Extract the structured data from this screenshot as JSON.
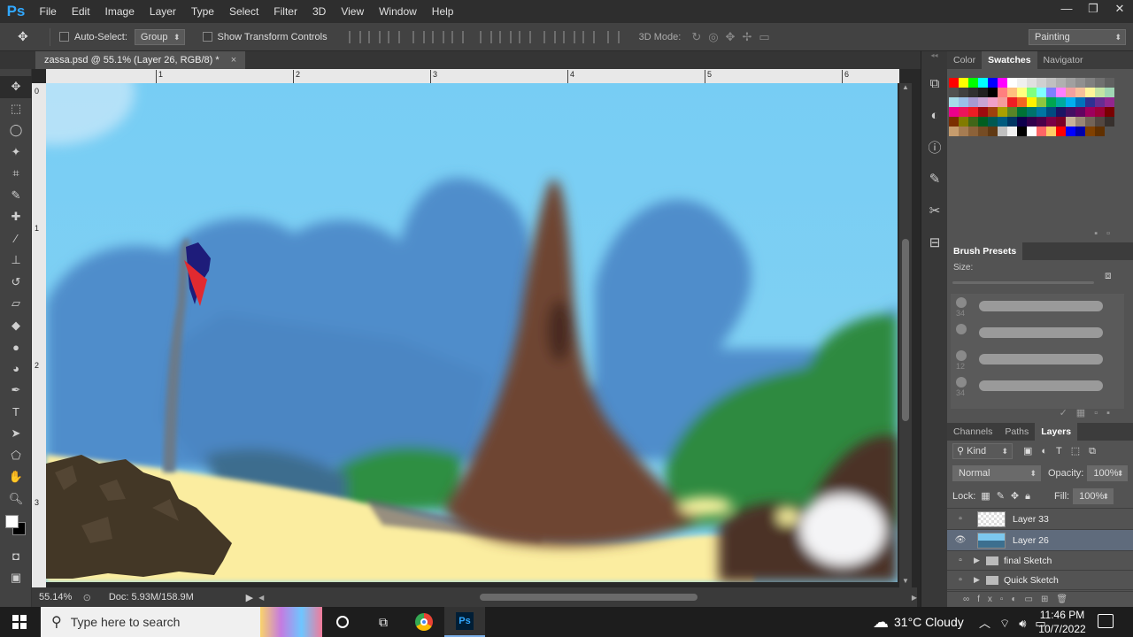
{
  "app": {
    "logo": "Ps"
  },
  "menu": [
    "File",
    "Edit",
    "Image",
    "Layer",
    "Type",
    "Select",
    "Filter",
    "3D",
    "View",
    "Window",
    "Help"
  ],
  "window_controls": {
    "minimize": "—",
    "maximize": "❐",
    "close": "✕"
  },
  "options": {
    "auto_select_label": "Auto-Select:",
    "auto_select_value": "Group",
    "show_transform_label": "Show Transform Controls",
    "mode_3d_label": "3D Mode:",
    "workspace": "Painting"
  },
  "document": {
    "tab_title": "zassa.psd @ 55.1% (Layer 26, RGB/8) *",
    "close": "×"
  },
  "ruler": {
    "top": [
      "1",
      "2",
      "3",
      "4",
      "5",
      "6"
    ],
    "left": [
      "0",
      "1",
      "2",
      "3"
    ]
  },
  "status": {
    "zoom": "55.14%",
    "doc": "Doc: 5.93M/158.9M"
  },
  "panels": {
    "color_tabs": [
      "Color",
      "Swatches",
      "Navigator"
    ],
    "active_color_tab": "Swatches",
    "brush_presets_title": "Brush Presets",
    "brush_size_label": "Size:",
    "brush_sizes": [
      "34",
      "",
      "12",
      "34"
    ],
    "layer_tabs": [
      "Channels",
      "Paths",
      "Layers"
    ],
    "active_layer_tab": "Layers",
    "filter_kind": "Kind",
    "blend_mode": "Normal",
    "opacity_label": "Opacity:",
    "opacity_value": "100%",
    "lock_label": "Lock:",
    "fill_label": "Fill:",
    "fill_value": "100%"
  },
  "layers": [
    {
      "name": "Layer 33",
      "visible": false,
      "type": "layer",
      "selected": false
    },
    {
      "name": "Layer 26",
      "visible": true,
      "type": "layer",
      "selected": true
    },
    {
      "name": "final Sketch",
      "visible": false,
      "type": "group",
      "selected": false
    },
    {
      "name": "Quick Sketch",
      "visible": false,
      "type": "group",
      "selected": false
    }
  ],
  "swatches": [
    "#ff0000",
    "#ffff00",
    "#00ff00",
    "#00ffff",
    "#0000ff",
    "#ff00ff",
    "#ffffff",
    "#f0f0f0",
    "#e0e0e0",
    "#d0d0d0",
    "#c0c0c0",
    "#b0b0b0",
    "#a0a0a0",
    "#909090",
    "#808080",
    "#707070",
    "#606060",
    "#505050",
    "#404040",
    "#303030",
    "#202020",
    "#000000",
    "#ff7f7f",
    "#ffbf7f",
    "#ffff7f",
    "#7fff7f",
    "#7fffff",
    "#7f7fff",
    "#ff7fff",
    "#f0a0a0",
    "#f5c09a",
    "#fff599",
    "#c3e4a4",
    "#a0d6b4",
    "#a6dcea",
    "#9bc0e8",
    "#a79bd1",
    "#c8a4d4",
    "#f0a0c8",
    "#f49c9c",
    "#ee1d24",
    "#f26522",
    "#fff200",
    "#8dc63f",
    "#00a651",
    "#00a99d",
    "#00aeef",
    "#0072bc",
    "#2e3192",
    "#662d91",
    "#92278f",
    "#ec008c",
    "#ed145b",
    "#ed1c24",
    "#9e0b0f",
    "#a0410d",
    "#aba000",
    "#598527",
    "#007236",
    "#00746b",
    "#0076a3",
    "#004a80",
    "#1b1464",
    "#440e62",
    "#630460",
    "#9e005d",
    "#9e0039",
    "#790000",
    "#7b2e00",
    "#827b00",
    "#406618",
    "#005e20",
    "#005952",
    "#005b7f",
    "#003663",
    "#0d004c",
    "#32004b",
    "#4b0049",
    "#7b0046",
    "#7a0026",
    "#c7b299",
    "#998675",
    "#736357",
    "#534741",
    "#37302d",
    "#c69c6d",
    "#a67c52",
    "#8c6239",
    "#754c24",
    "#603913",
    "#c0c0c0",
    "#f0f0f0",
    "#000000",
    "#ffffff",
    "#ff6666",
    "#ffcc66",
    "#ff0000",
    "#0000ff",
    "#0000aa",
    "#804000",
    "#603000"
  ],
  "taskbar": {
    "search_placeholder": "Type here to search",
    "weather": "31°C  Cloudy",
    "time": "11:46 PM",
    "date": "10/7/2022"
  }
}
